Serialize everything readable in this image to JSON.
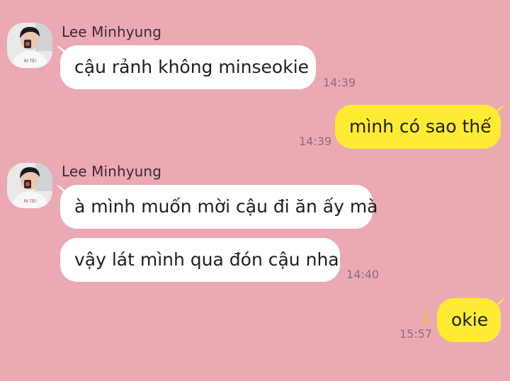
{
  "chat": {
    "contact_name": "Lee Minhyung",
    "messages": [
      {
        "from": "contact",
        "text": "cậu rảnh không minseokie",
        "time": "14:39"
      },
      {
        "from": "me",
        "text": "mình có sao thế",
        "time": "14:39"
      },
      {
        "from": "contact",
        "text": "à mình muốn mời cậu đi ăn ấy mà"
      },
      {
        "from": "contact",
        "text": "vậy lát mình qua đón cậu nha",
        "time": "14:40"
      },
      {
        "from": "me",
        "text": "okie",
        "time": "15:57",
        "unread_count": "1"
      }
    ]
  },
  "colors": {
    "background": "#EBA9B3",
    "incoming_bubble": "#FFFFFF",
    "outgoing_bubble": "#FEEB33",
    "unread_indicator": "#E2C23A"
  },
  "icons": {
    "avatar": "profile-photo-avatar"
  }
}
